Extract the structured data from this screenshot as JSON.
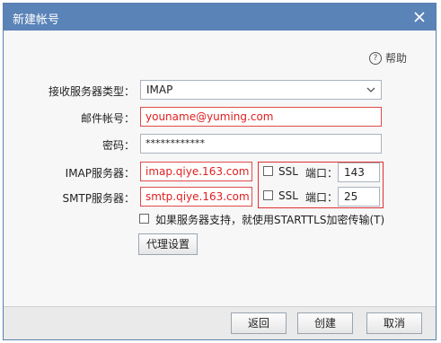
{
  "dialog": {
    "title": "新建帐号",
    "help_label": "帮助",
    "help_icon": "question-circle-icon",
    "close_icon": "close-icon"
  },
  "form": {
    "server_type": {
      "label": "接收服务器类型：",
      "value": "IMAP"
    },
    "account": {
      "label": "邮件帐号：",
      "value": "youname@yuming.com"
    },
    "password": {
      "label": "密码：",
      "value": "************"
    },
    "imap": {
      "label": "IMAP服务器：",
      "value": "imap.qiye.163.com",
      "ssl_label": "SSL",
      "port_label": "端口：",
      "port_value": "143"
    },
    "smtp": {
      "label": "SMTP服务器：",
      "value": "smtp.qiye.163.com",
      "ssl_label": "SSL",
      "port_label": "端口：",
      "port_value": "25"
    },
    "starttls_label": "如果服务器支持，就使用STARTTLS加密传输(T)",
    "proxy_button": "代理设置"
  },
  "footer": {
    "back_button": "返回",
    "create_button": "创建",
    "cancel_button": "取消"
  },
  "colors": {
    "titlebar": "#5a83b8",
    "highlight_red": "#e03030"
  }
}
